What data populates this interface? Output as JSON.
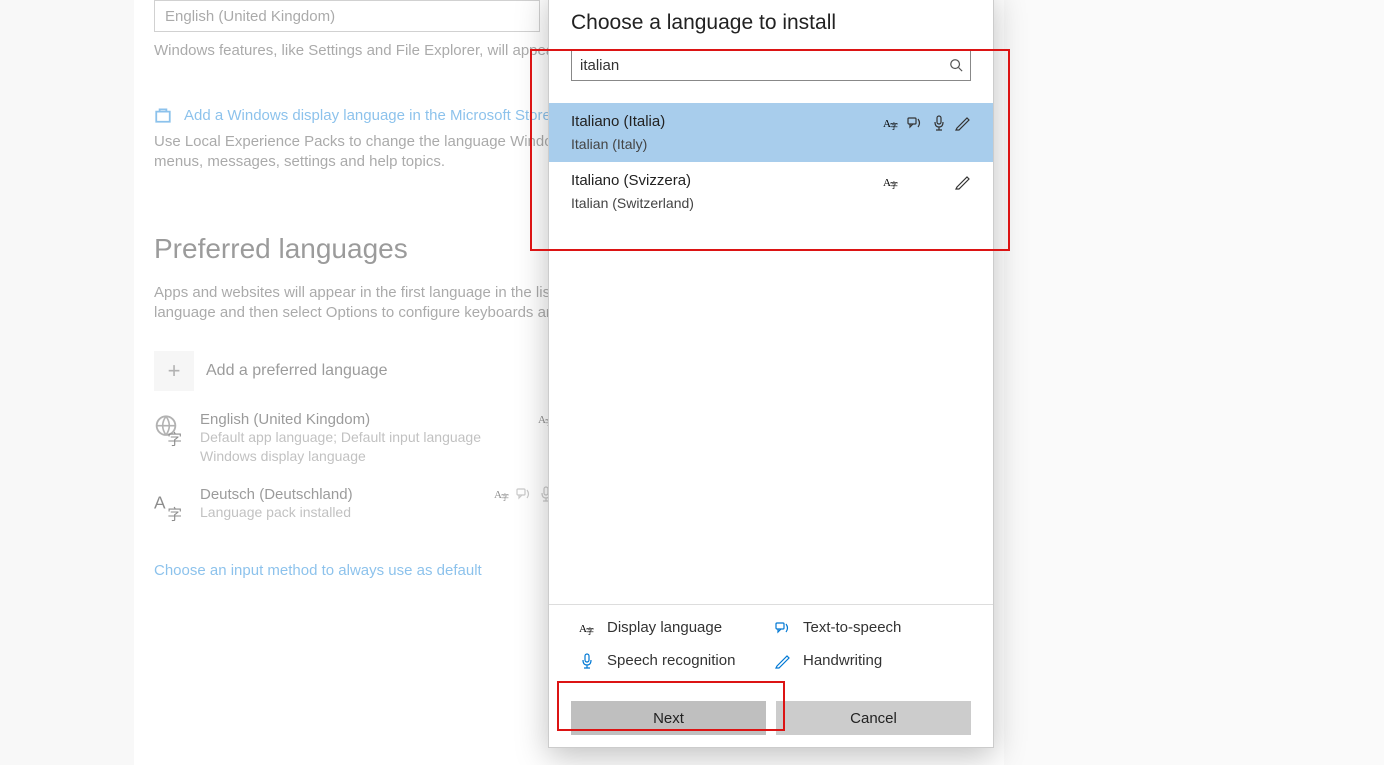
{
  "main": {
    "display_language_value": "English (United Kingdom)",
    "features_text": "Windows features, like Settings and File Explorer, will appear in this language.",
    "store_link": "Add a Windows display language in the Microsoft Store",
    "lep_text": "Use Local Experience Packs to change the language Windows uses for navigation, menus, messages, settings and help topics.",
    "preferred_header": "Preferred languages",
    "preferred_desc": "Apps and websites will appear in the first language in the list that they support. Select a language and then select Options to configure keyboards and other features.",
    "add_preferred": "Add a preferred language",
    "languages": [
      {
        "name": "English (United Kingdom)",
        "sub": "Default app language; Default input language\nWindows display language"
      },
      {
        "name": "Deutsch (Deutschland)",
        "sub": "Language pack installed"
      }
    ],
    "choose_input": "Choose an input method to always use as default"
  },
  "dialog": {
    "title": "Choose a language to install",
    "search_value": "italian",
    "results": [
      {
        "native": "Italiano (Italia)",
        "english": "Italian (Italy)",
        "selected": true,
        "features": [
          "display",
          "tts",
          "speech",
          "handwriting"
        ]
      },
      {
        "native": "Italiano (Svizzera)",
        "english": "Italian (Switzerland)",
        "selected": false,
        "features": [
          "display",
          "handwriting"
        ]
      }
    ],
    "legend": {
      "display": "Display language",
      "tts": "Text-to-speech",
      "speech": "Speech recognition",
      "handwriting": "Handwriting"
    },
    "next": "Next",
    "cancel": "Cancel"
  }
}
